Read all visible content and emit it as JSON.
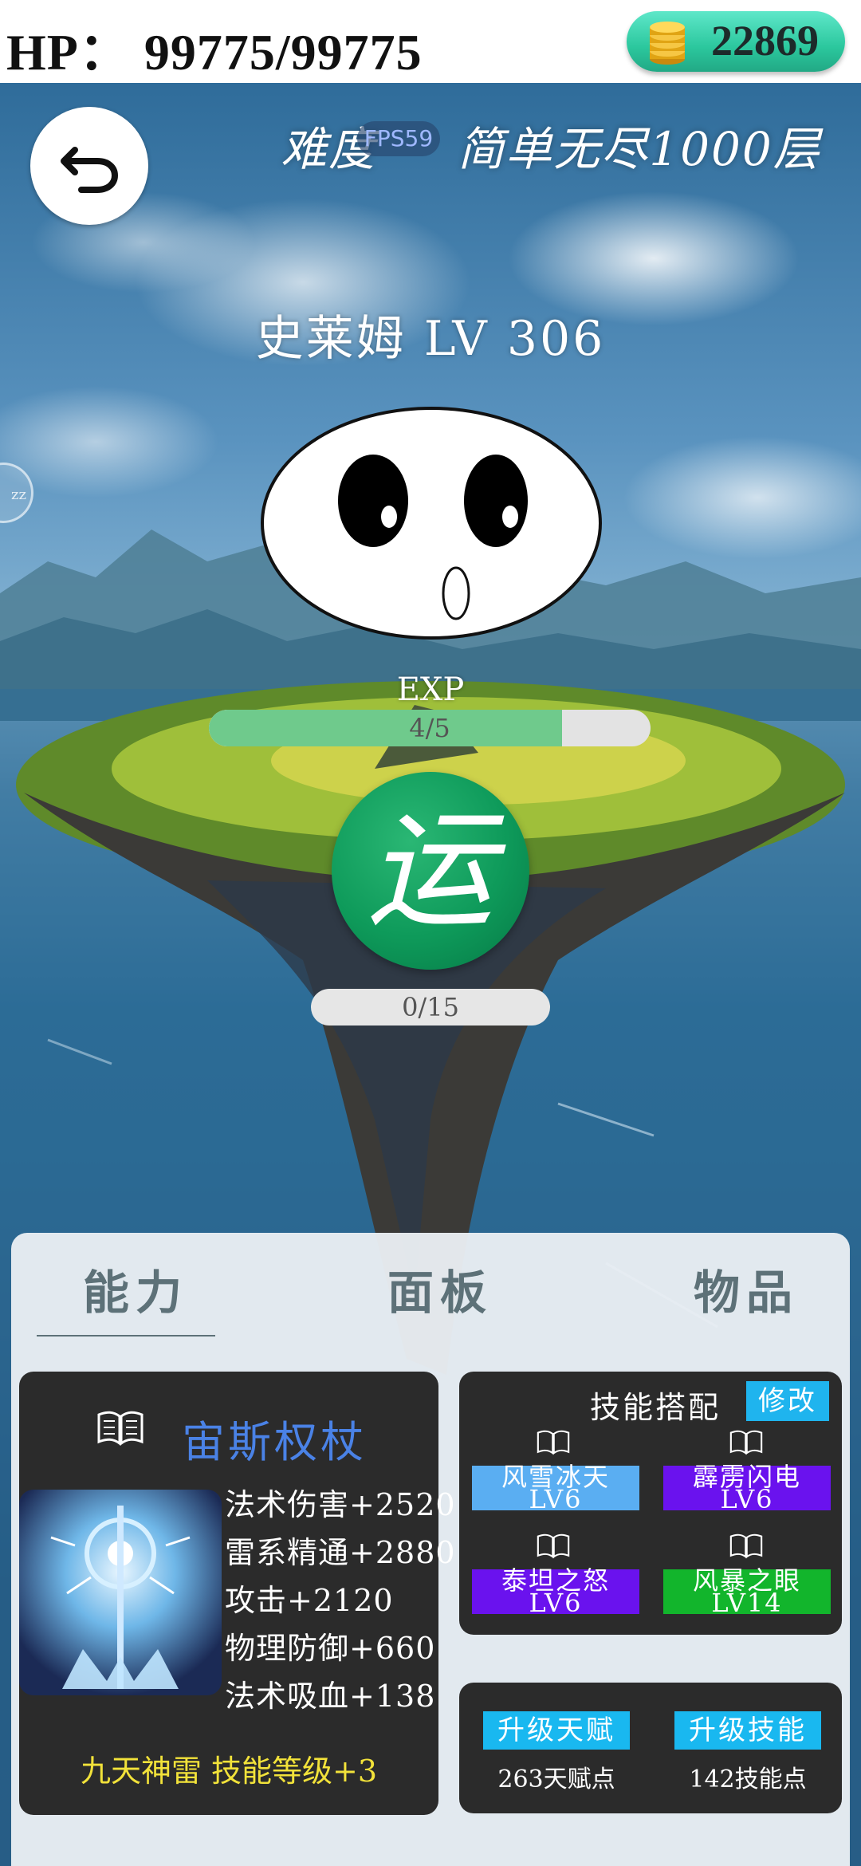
{
  "header": {
    "hp": "HP：  99775/99775",
    "gold": "22869"
  },
  "stage": {
    "difficulty_label": "难度",
    "fps": "FPS59",
    "mode": "简单无尽1000层"
  },
  "monster": {
    "name": "史莱姆 LV 306"
  },
  "exp": {
    "label": "EXP",
    "text": "4/5",
    "current": 4,
    "max": 5
  },
  "luck": {
    "char": "运",
    "text": "0/15",
    "current": 0,
    "max": 15
  },
  "tabs": [
    "能力",
    "面板",
    "物品"
  ],
  "weapon": {
    "name": "宙斯权杖",
    "stats": [
      "法术伤害+2520",
      "雷系精通+2880",
      "攻击+2120",
      "物理防御+660",
      "法术吸血+138"
    ],
    "bonus": "九天神雷 技能等级+3"
  },
  "skills": {
    "title": "技能搭配",
    "modify_label": "修改",
    "items": [
      {
        "name": "风雪冰天",
        "level": "LV6",
        "color": "#5aaef2"
      },
      {
        "name": "霹雳闪电",
        "level": "LV6",
        "color": "#6a12ee"
      },
      {
        "name": "泰坦之怒",
        "level": "LV6",
        "color": "#6a12ee"
      },
      {
        "name": "风暴之眼",
        "level": "LV14",
        "color": "#12b52c"
      }
    ]
  },
  "upgrade": {
    "talent_button": "升级天赋",
    "talent_points": "263天赋点",
    "skill_button": "升级技能",
    "skill_points": "142技能点"
  }
}
